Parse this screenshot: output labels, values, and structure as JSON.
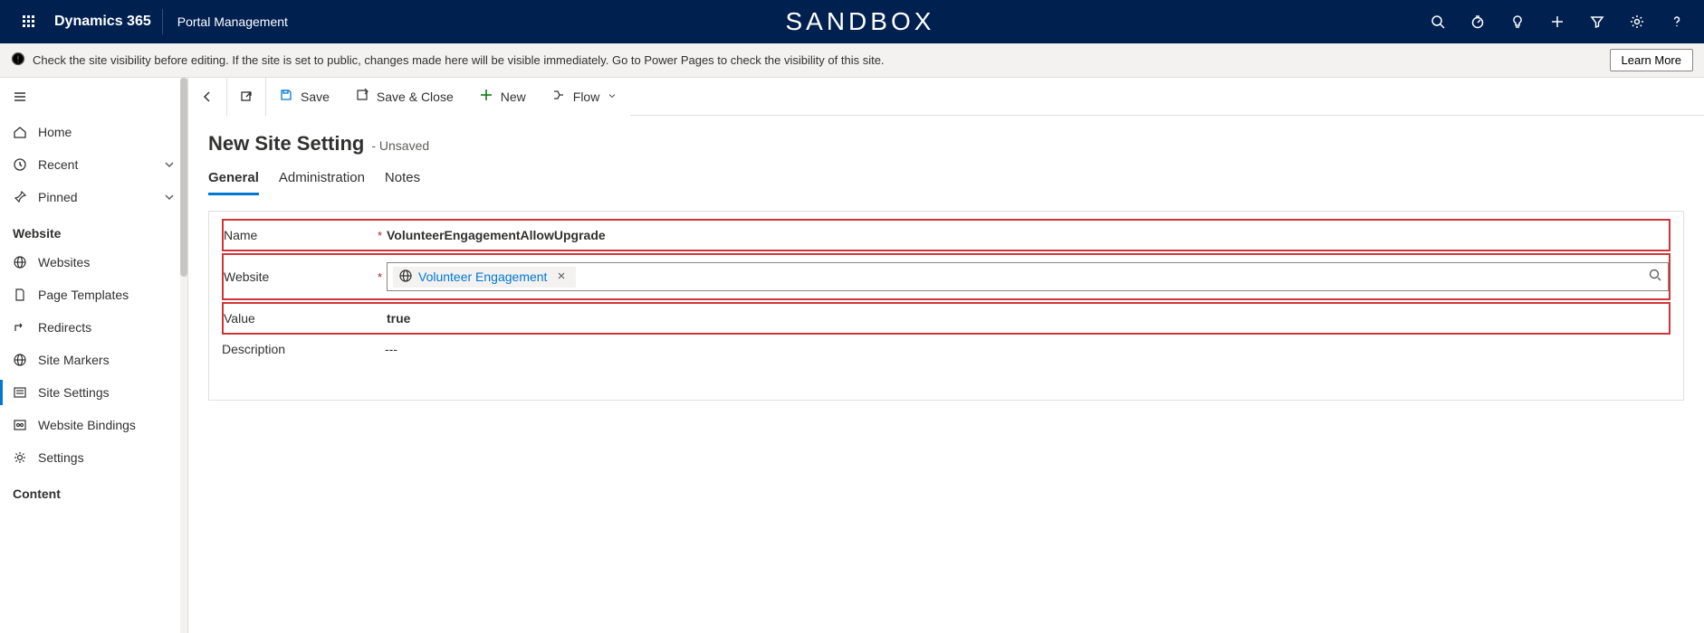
{
  "topnav": {
    "brand": "Dynamics 365",
    "appname": "Portal Management",
    "center_label": "SANDBOX"
  },
  "infobar": {
    "message": "Check the site visibility before editing. If the site is set to public, changes made here will be visible immediately. Go to Power Pages to check the visibility of this site.",
    "learn_more": "Learn More"
  },
  "sidebar": {
    "items_top": [
      {
        "label": "Home"
      },
      {
        "label": "Recent"
      },
      {
        "label": "Pinned"
      }
    ],
    "section1": "Website",
    "items_website": [
      {
        "label": "Websites"
      },
      {
        "label": "Page Templates"
      },
      {
        "label": "Redirects"
      },
      {
        "label": "Site Markers"
      },
      {
        "label": "Site Settings"
      },
      {
        "label": "Website Bindings"
      },
      {
        "label": "Settings"
      }
    ],
    "section2": "Content"
  },
  "cmdbar": {
    "save": "Save",
    "save_close": "Save & Close",
    "new": "New",
    "flow": "Flow"
  },
  "form": {
    "title": "New Site Setting",
    "subtitle": "- Unsaved",
    "tabs": {
      "general": "General",
      "administration": "Administration",
      "notes": "Notes"
    },
    "rows": {
      "name": {
        "label": "Name",
        "value": "VolunteerEngagementAllowUpgrade"
      },
      "website": {
        "label": "Website",
        "value": "Volunteer Engagement"
      },
      "value": {
        "label": "Value",
        "value": "true"
      },
      "description": {
        "label": "Description",
        "value": "---"
      }
    }
  }
}
